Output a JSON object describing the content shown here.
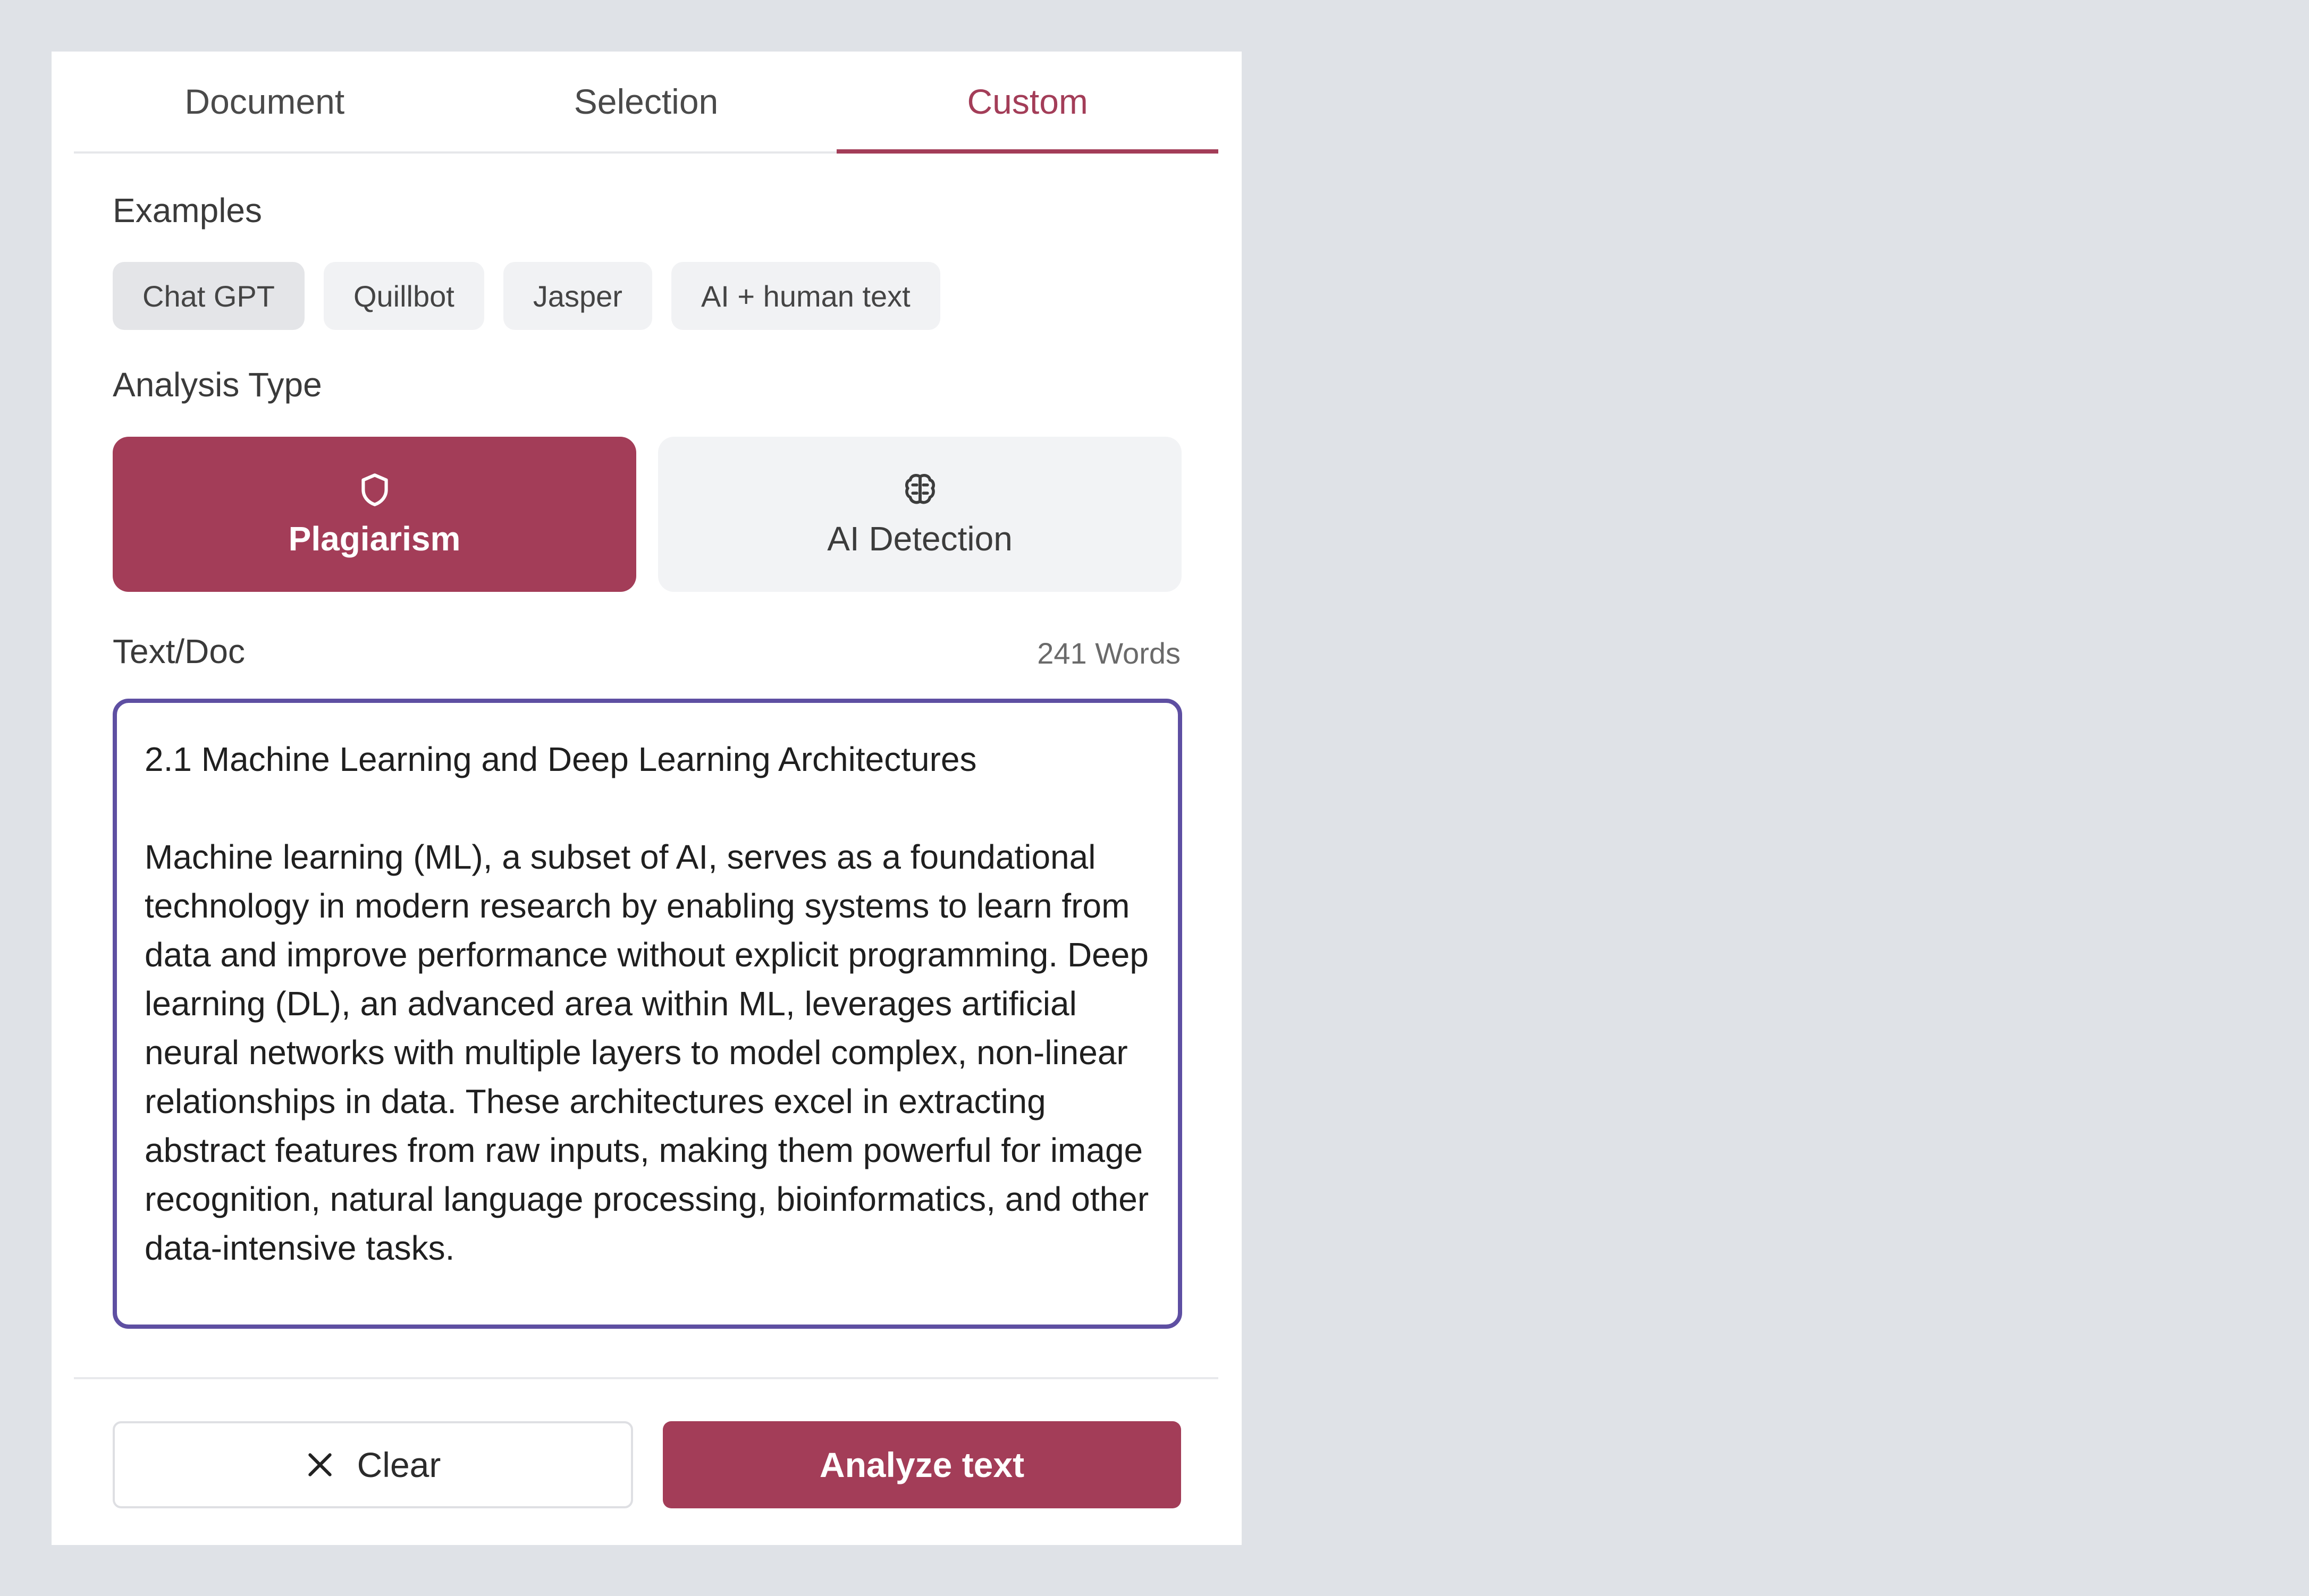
{
  "tabs": {
    "document": "Document",
    "selection": "Selection",
    "custom": "Custom",
    "active": "Custom"
  },
  "examples": {
    "label": "Examples",
    "chips": [
      "Chat GPT",
      "Quillbot",
      "Jasper",
      "AI + human text"
    ]
  },
  "analysis": {
    "label": "Analysis Type",
    "plagiarism": {
      "label": "Plagiarism",
      "icon": "shield-icon",
      "selected": true
    },
    "ai_detection": {
      "label": "AI Detection",
      "icon": "brain-icon",
      "selected": false
    }
  },
  "text": {
    "label": "Text/Doc",
    "word_count": "241 Words",
    "heading": "2.1 Machine Learning and Deep Learning Architectures",
    "body": "Machine learning (ML), a subset of AI, serves as a foundational technology in modern research by enabling systems to learn from data and improve performance without explicit programming. Deep learning (DL), an advanced area within ML, leverages artificial neural networks with multiple layers to model complex, non-linear relationships in data. These architectures excel in extracting abstract features from raw inputs, making them powerful for image recognition, natural language processing, bioinformatics, and other data-intensive tasks."
  },
  "actions": {
    "clear": "Clear",
    "analyze": "Analyze text"
  },
  "colors": {
    "accent": "#a33d58",
    "focus_border": "#5e4fa2"
  }
}
